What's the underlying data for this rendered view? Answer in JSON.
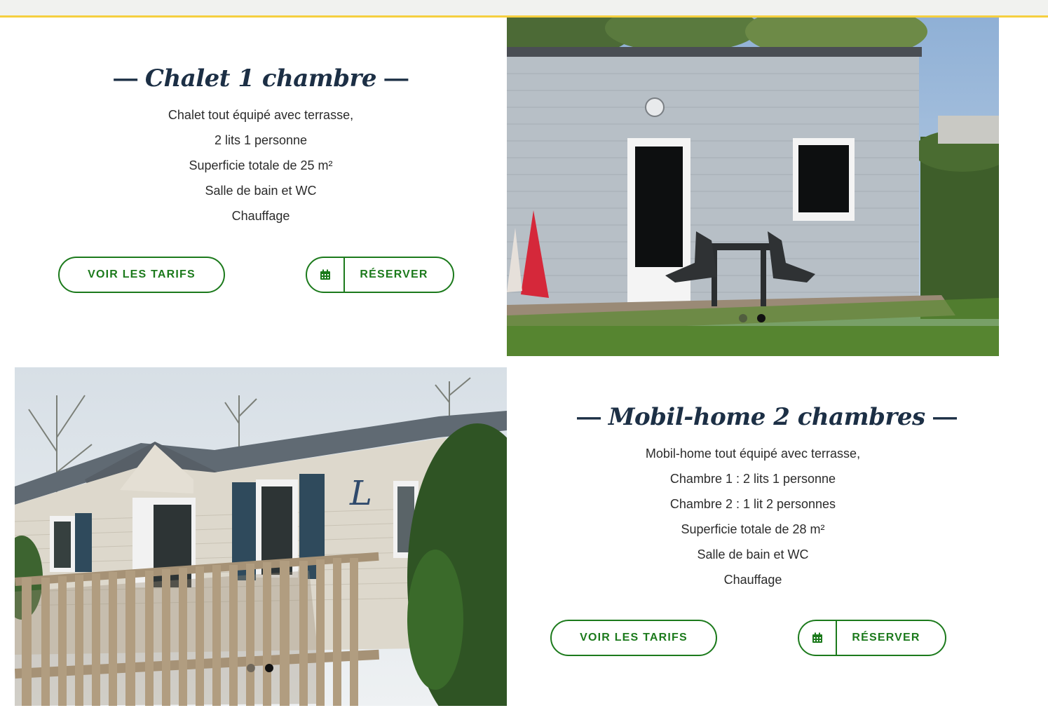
{
  "section1": {
    "title": "Chalet 1 chambre",
    "dash_left": "—",
    "dash_right": "—",
    "lines": [
      "Chalet tout équipé avec terrasse,",
      "2 lits 1 personne",
      "Superficie totale de 25 m²",
      "Salle de bain et WC",
      "Chauffage"
    ],
    "tarifs_label": "VOIR LES TARIFS",
    "reserve_label": "RÉSERVER",
    "calendar_icon": "calendar-icon",
    "slider": {
      "slides": 2,
      "active": 2
    }
  },
  "section2": {
    "title": "Mobil-home 2 chambres",
    "dash_left": "—",
    "dash_right": "—",
    "lines": [
      "Mobil-home tout équipé avec terrasse,",
      "Chambre 1 : 2 lits 1 personne",
      "Chambre 2 : 1 lit 2 personnes",
      "Superficie totale de 28 m²",
      "Salle de bain et WC",
      "Chauffage"
    ],
    "tarifs_label": "VOIR LES TARIFS",
    "reserve_label": "RÉSERVER",
    "calendar_icon": "calendar-icon",
    "slider": {
      "slides": 2,
      "active": 2
    }
  },
  "colors": {
    "accent_green": "#1c7a1c",
    "title_navy": "#1c2f45",
    "top_border_yellow": "#f5cf3f"
  }
}
